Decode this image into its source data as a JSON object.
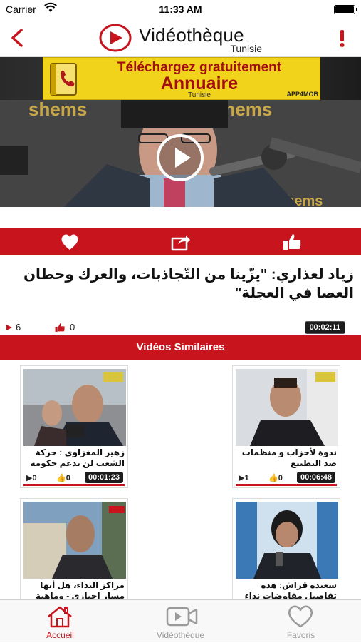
{
  "status_bar": {
    "carrier": "Carrier",
    "time": "11:33 AM"
  },
  "header": {
    "title": "Vidéothèque",
    "subtitle": "Tunisie"
  },
  "ad": {
    "line1": "Téléchargez gratuitement",
    "line2": "Annuaire",
    "line3": "Tunisie",
    "badge": "APP4MOB"
  },
  "video": {
    "title": "زياد لعذاري: \"يزّينا من التّجاذبات، والعرك وحطان العصا في العجلة\"",
    "views": "6",
    "likes": "0",
    "duration": "00:02:11"
  },
  "similar": {
    "header": "Vidéos Similaires",
    "items": [
      {
        "title": "زهير المغزاوي : حركة الشعب لن تدعم حكومة",
        "views": "0",
        "likes": "0",
        "duration": "00:01:23"
      },
      {
        "title": "ندوة لأحزاب و منظمات ضد التطبيع",
        "views": "1",
        "likes": "0",
        "duration": "00:06:48"
      },
      {
        "title": "مراكز النداء، هل أنها مسار إجباري - وماهية مشاكلها",
        "views": "",
        "likes": "",
        "duration": ""
      },
      {
        "title": "سعيدة قراش: هذه تفاصيل مفاوضات نداء تونس مع",
        "views": "",
        "likes": "",
        "duration": ""
      }
    ]
  },
  "tabs": [
    {
      "label": "Accueil",
      "active": true
    },
    {
      "label": "Vidéothèque",
      "active": false
    },
    {
      "label": "Favoris",
      "active": false
    }
  ],
  "colors": {
    "accent": "#c8141c",
    "ad_bg": "#f2d31b",
    "tab_inactive": "#9a9a9a"
  },
  "icons": [
    "wifi-icon",
    "battery-icon",
    "back-icon",
    "alert-icon",
    "play-logo-icon",
    "phone-book-icon",
    "play-icon",
    "heart-icon",
    "share-icon",
    "thumbs-up-icon",
    "eye-icon",
    "home-icon",
    "video-camera-icon",
    "favorites-heart-icon"
  ]
}
